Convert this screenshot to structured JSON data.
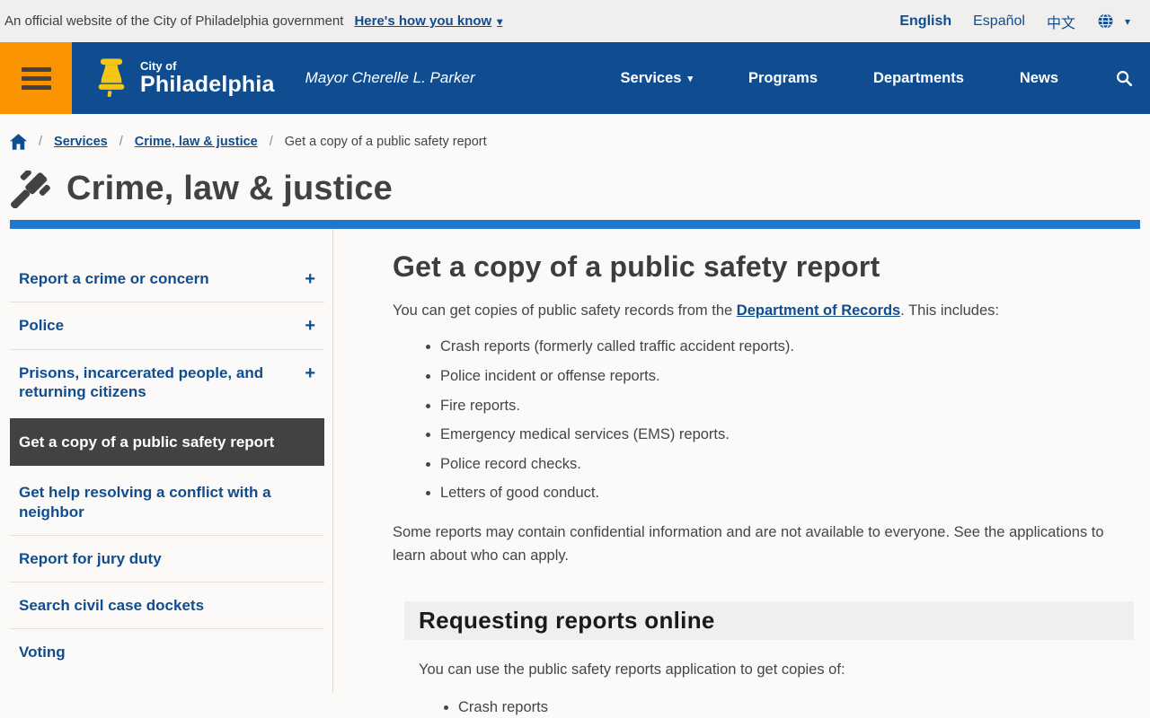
{
  "banner": {
    "official_text": "An official website of the City of Philadelphia government",
    "how_you_know_label": "Here's how you know",
    "languages": [
      {
        "label": "English",
        "current": true
      },
      {
        "label": "Español",
        "current": false
      },
      {
        "label": "中文",
        "current": false
      }
    ]
  },
  "nav": {
    "logo_line1": "City of",
    "logo_line2": "Philadelphia",
    "mayor_text": "Mayor Cherelle L. Parker",
    "items": [
      {
        "label": "Services",
        "has_dropdown": true
      },
      {
        "label": "Programs",
        "has_dropdown": false
      },
      {
        "label": "Departments",
        "has_dropdown": false
      },
      {
        "label": "News",
        "has_dropdown": false
      }
    ]
  },
  "breadcrumb": {
    "separator": "/",
    "links": [
      {
        "label": "Services"
      },
      {
        "label": "Crime, law & justice"
      }
    ],
    "current": "Get a copy of a public safety report"
  },
  "page": {
    "title": "Crime, law & justice"
  },
  "sidebar": {
    "items": [
      {
        "label": "Report a crime or concern",
        "expandable": true,
        "active": false
      },
      {
        "label": "Police",
        "expandable": true,
        "active": false
      },
      {
        "label": "Prisons, incarcerated people, and returning citizens",
        "expandable": true,
        "active": false
      },
      {
        "label": "Get a copy of a public safety report",
        "expandable": false,
        "active": true
      },
      {
        "label": "Get help resolving a conflict with a neighbor",
        "expandable": false,
        "active": false
      },
      {
        "label": "Report for jury duty",
        "expandable": false,
        "active": false
      },
      {
        "label": "Search civil case dockets",
        "expandable": false,
        "active": false
      },
      {
        "label": "Voting",
        "expandable": false,
        "active": false
      }
    ]
  },
  "main": {
    "heading": "Get a copy of a public safety report",
    "intro_before_link": "You can get copies of public safety records from the ",
    "intro_link": "Department of Records",
    "intro_after_link": ". This includes:",
    "report_types": [
      "Crash reports (formerly called traffic accident reports).",
      "Police incident or offense reports.",
      "Fire reports.",
      "Emergency medical services (EMS) reports.",
      "Police record checks.",
      "Letters of good conduct."
    ],
    "confidential_note": "Some reports may contain confidential information and are not available to everyone. See the applications to learn about who can apply.",
    "online_section": {
      "heading": "Requesting reports online",
      "intro": "You can use the public safety reports application to get copies of:",
      "items": [
        "Crash reports"
      ]
    }
  },
  "icons": {
    "caret_down": "▾",
    "plus": "+"
  },
  "colors": {
    "nav_blue": "#0f4d90",
    "accent_blue": "#2176d2",
    "orange": "#f99300",
    "bell_yellow": "#f3c613",
    "active_item_bg": "#424242",
    "topbar_bg": "#f0efed"
  }
}
